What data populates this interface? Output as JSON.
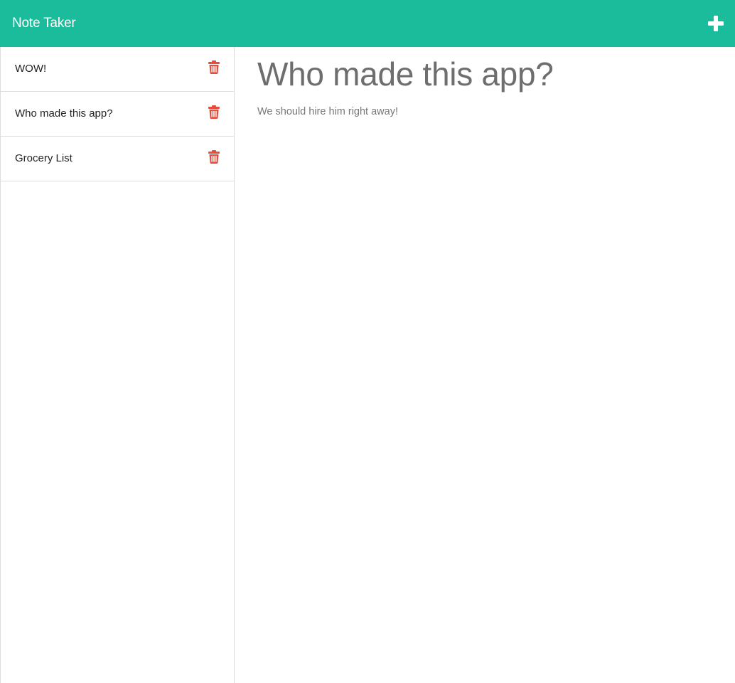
{
  "navbar": {
    "brand": "Note Taker",
    "new_note_icon": "plus-icon",
    "background_color": "#1abc9c"
  },
  "sidebar": {
    "notes": [
      {
        "title": "WOW!",
        "delete_icon": "trash-icon"
      },
      {
        "title": "Who made this app?",
        "delete_icon": "trash-icon"
      },
      {
        "title": "Grocery List",
        "delete_icon": "trash-icon"
      }
    ],
    "delete_icon_color": "#e74c3c"
  },
  "active_note": {
    "title": "Who made this app?",
    "text": "We should hire him right away!"
  }
}
